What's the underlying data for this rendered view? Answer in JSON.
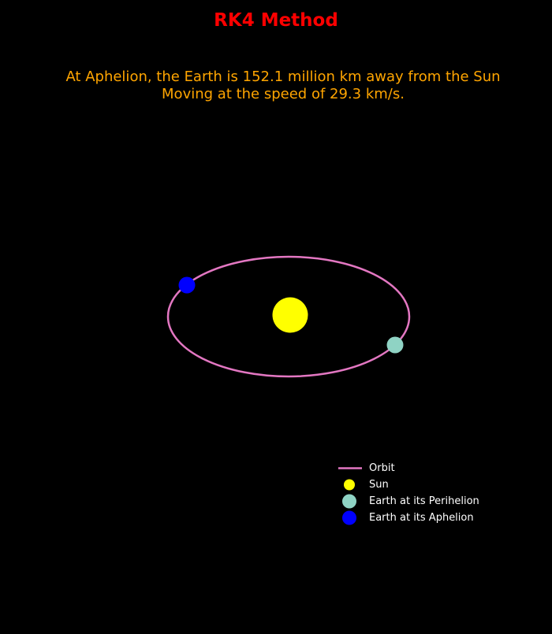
{
  "title": "RK4 Method",
  "subtitle": {
    "line1": "At Aphelion, the Earth is 152.1 million km away from the Sun",
    "line2": "Moving at the speed of 29.3 km/s."
  },
  "colors": {
    "background": "#000000",
    "title": "#ff0000",
    "subtitle": "#ffa500",
    "orbit": "#e377c2",
    "sun": "#ffff00",
    "perihelion": "#8fd3c4",
    "aphelion": "#0000ff",
    "legend_text": "#ffffff"
  },
  "legend": {
    "orbit": "Orbit",
    "sun": "Sun",
    "perihelion": "Earth at its Perihelion",
    "aphelion": "Earth at its Aphelion"
  }
}
